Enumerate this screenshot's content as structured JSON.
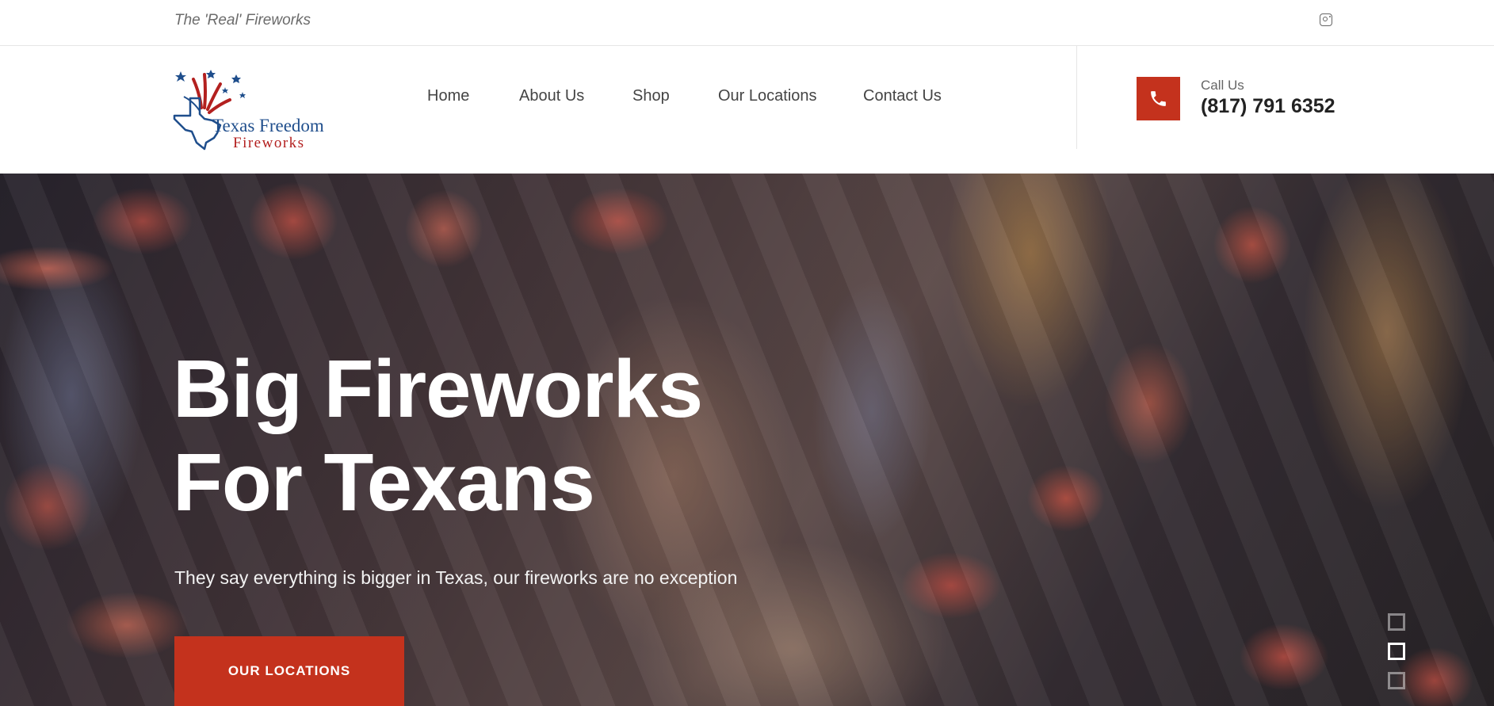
{
  "topbar": {
    "tagline": "The 'Real' Fireworks",
    "social_icon": "instagram-icon"
  },
  "header": {
    "logo": {
      "line1": "Texas Freedom",
      "line2": "Fireworks"
    },
    "nav": [
      {
        "label": "Home"
      },
      {
        "label": "About Us"
      },
      {
        "label": "Shop"
      },
      {
        "label": "Our Locations"
      },
      {
        "label": "Contact Us"
      }
    ],
    "call": {
      "icon": "phone-icon",
      "label": "Call Us",
      "number": "(817) 791 6352"
    }
  },
  "hero": {
    "title_line1": "Big Fireworks",
    "title_line2": "For Texans",
    "subtitle": "They say everything is bigger in Texas, our fireworks are no exception",
    "cta_label": "OUR LOCATIONS",
    "slides": 3,
    "active_slide": 2
  },
  "colors": {
    "accent": "#c4321d",
    "logo_blue": "#1f4e8c",
    "logo_red": "#b3201f"
  }
}
